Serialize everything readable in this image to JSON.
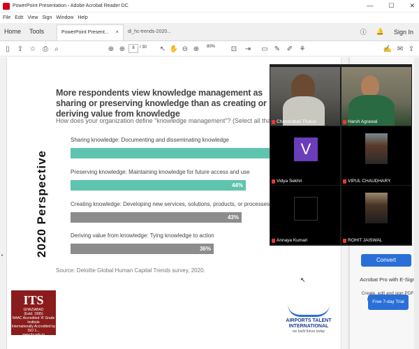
{
  "window": {
    "title": "PowerPoint Presentation - Adobe Acrobat Reader DC",
    "controls": [
      "—",
      "☐",
      "✕"
    ]
  },
  "menu": [
    "File",
    "Edit",
    "View",
    "Sign",
    "Window",
    "Help"
  ],
  "tabs": {
    "home": "Home",
    "tools": "Tools",
    "active_doc": "PowerPoint Present...",
    "other_doc": "di_hc-trends-2020...",
    "close": "×",
    "signin": "Sign In"
  },
  "toolbar": {
    "page_current": "8",
    "page_total": "/ 30",
    "zoom": "80%"
  },
  "slide": {
    "title": "More respondents view knowledge management as sharing or preserving knowledge than as creating or deriving value from knowledge",
    "subtitle": "How does your organization define \"knowledge management\"? (Select all that apply.)",
    "vertical_label": "2020 Perspective",
    "source": "Source: Deloitte Global Human Capital Trends survey, 2020."
  },
  "chart_data": {
    "type": "bar",
    "categories": [
      "Sharing knowledge: Documenting and disseminating knowledge",
      "Preserving knowledge: Maintaining knowledge for future access and use",
      "Creating knowledge: Developing new services, solutions, products, or processes",
      "Deriving value from knowledge: Tying knowledge to action"
    ],
    "labels": [
      "",
      "44%",
      "43%",
      "36%"
    ],
    "values": [
      null,
      44,
      43,
      36
    ],
    "colors": [
      "#5ec4ae",
      "#5ec4ae",
      "#8c8c8c",
      "#8c8c8c"
    ]
  },
  "logos": {
    "its": {
      "name": "ITS",
      "place": "GHAZIABAD",
      "est": "(Estd. 1995)",
      "line1": "NAAC Accredited 'A' Grade Institute",
      "line2": "Internationally Accredited by ISO 1...",
      "url": "www.its.edu.in"
    },
    "ati": {
      "name": "AIRPORTS TALENT INTERNATIONAL",
      "tag": "we build future today"
    }
  },
  "participants": [
    {
      "name": "Chandrabali Thakur"
    },
    {
      "name": "Harsh Agrawal"
    },
    {
      "name": "Vidya Sekhri",
      "initial": "V"
    },
    {
      "name": "VIPUL CHAUDHARY"
    },
    {
      "name": "Annaya Kumari"
    },
    {
      "name": "ROHIT JAISWAL"
    }
  ],
  "right_panel": {
    "convert": "Convert",
    "promo_title": "Acrobat Pro with E-Sign",
    "promo_text": "Create, edit and sign PDF forms & agreements",
    "trial": "Free 7-day Trial"
  },
  "colors": {
    "accent": "#2a6fd8",
    "teal": "#5ec4ae",
    "gray": "#8c8c8c",
    "its_red": "#8a1c1c"
  }
}
